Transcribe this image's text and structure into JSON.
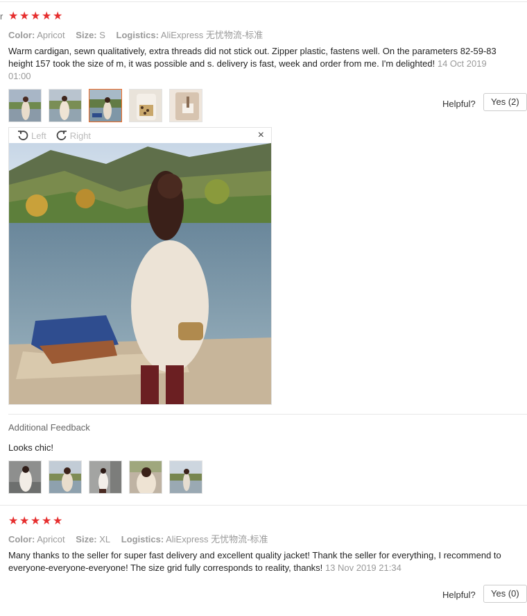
{
  "colors": {
    "star": "#e62e2e",
    "accent": "#f36a1f"
  },
  "review1": {
    "stars": 5,
    "attrs": [
      {
        "key": "Color:",
        "value": "Apricot"
      },
      {
        "key": "Size:",
        "value": "S"
      },
      {
        "key": "Logistics:",
        "value": "AliExpress 无忧物流-标准"
      }
    ],
    "text": "Warm cardigan, sewn qualitatively, extra threads did not stick out. Zipper plastic, fastens well. On the parameters 82-59-83 height 157 took the size of m, it was possible and s. delivery is fast, week and order from me. I'm delighted!",
    "date": "14 Oct 2019 01:00",
    "helpful_label": "Helpful?",
    "yes_label": "Yes (2)",
    "viewer": {
      "left_label": "Left",
      "right_label": "Right",
      "close": "×"
    },
    "additional_title": "Additional Feedback",
    "additional_text": "Looks chic!"
  },
  "review2": {
    "stars": 5,
    "attrs": [
      {
        "key": "Color:",
        "value": "Apricot"
      },
      {
        "key": "Size:",
        "value": "XL"
      },
      {
        "key": "Logistics:",
        "value": "AliExpress 无忧物流-标准"
      }
    ],
    "text": "Many thanks to the seller for super fast delivery and excellent quality jacket! Thank the seller for everything, I recommend to everyone-everyone-everyone! The size grid fully corresponds to reality, thanks!",
    "date": "13 Nov 2019 21:34",
    "helpful_label": "Helpful?",
    "yes_label": "Yes (0)"
  },
  "left_edge_text": "r"
}
